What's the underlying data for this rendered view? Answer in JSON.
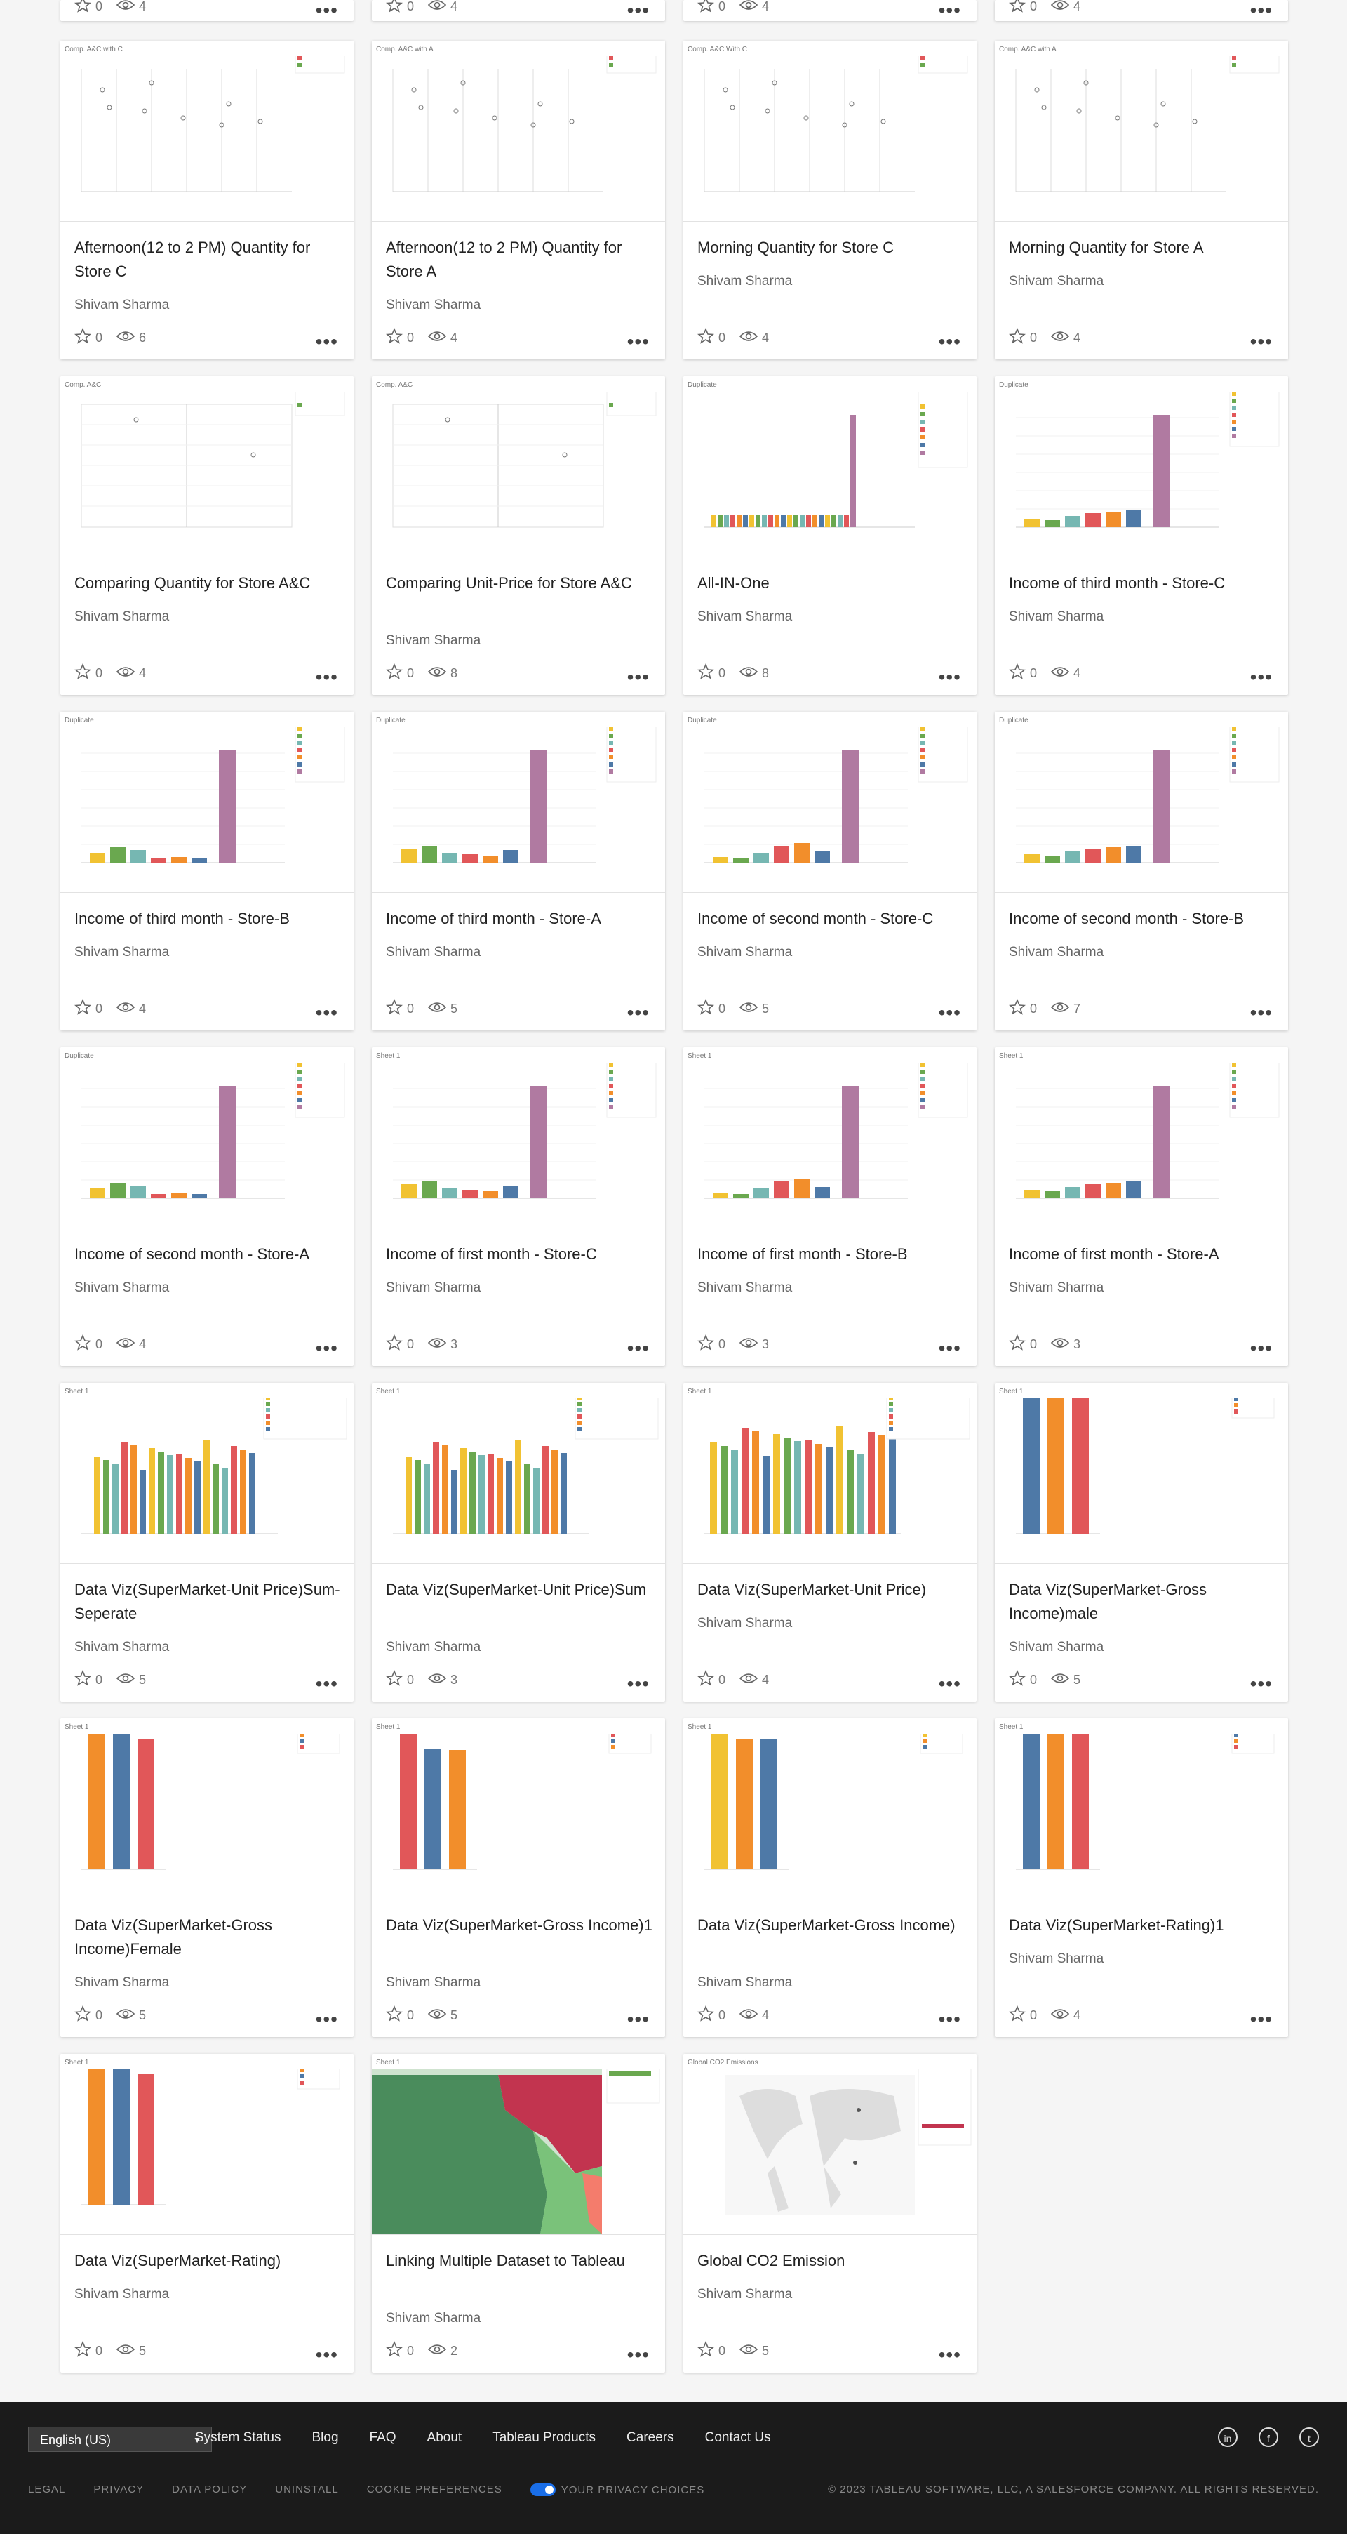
{
  "colors": {
    "accent": "#1a6ee8",
    "footer": "#1b1b1b",
    "card": "#ffffff",
    "bg": "#f5f5f5"
  },
  "top_partial": [
    {
      "favorites": "0",
      "views": "4"
    },
    {
      "favorites": "0",
      "views": "4"
    },
    {
      "favorites": "0",
      "views": "4"
    },
    {
      "favorites": "0",
      "views": "4"
    }
  ],
  "cards": [
    {
      "title": "Afternoon(12 to 2 PM) Quantity for Store C",
      "author": "Shivam Sharma",
      "favorites": "0",
      "views": "6",
      "thumb": "Comp. A&C with C",
      "kind": "scatter"
    },
    {
      "title": "Afternoon(12 to 2 PM) Quantity for Store A",
      "author": "Shivam Sharma",
      "favorites": "0",
      "views": "4",
      "thumb": "Comp. A&C with A",
      "kind": "scatter"
    },
    {
      "title": "Morning Quantity for Store C",
      "author": "Shivam Sharma",
      "favorites": "0",
      "views": "4",
      "thumb": "Comp. A&C With C",
      "kind": "scatter"
    },
    {
      "title": "Morning Quantity for Store A",
      "author": "Shivam Sharma",
      "favorites": "0",
      "views": "4",
      "thumb": "Comp. A&C with A",
      "kind": "scatter"
    },
    {
      "title": "Comparing Quantity for Store A&C",
      "author": "Shivam Sharma",
      "favorites": "0",
      "views": "4",
      "thumb": "Comp. A&C",
      "kind": "scatter2"
    },
    {
      "title": "Comparing Unit-Price for Store A&C",
      "author": "Shivam Sharma",
      "favorites": "0",
      "views": "8",
      "thumb": "Comp. A&C",
      "kind": "scatter2"
    },
    {
      "title": "All-IN-One",
      "author": "Shivam Sharma",
      "favorites": "0",
      "views": "8",
      "thumb": "Duplicate",
      "kind": "allin"
    },
    {
      "title": "Income of third month - Store-C",
      "author": "Shivam Sharma",
      "favorites": "0",
      "views": "4",
      "thumb": "Duplicate",
      "kind": "income"
    },
    {
      "title": "Income of third month - Store-B",
      "author": "Shivam Sharma",
      "favorites": "0",
      "views": "4",
      "thumb": "Duplicate",
      "kind": "income"
    },
    {
      "title": "Income of third month - Store-A",
      "author": "Shivam Sharma",
      "favorites": "0",
      "views": "5",
      "thumb": "Duplicate",
      "kind": "income"
    },
    {
      "title": "Income of second month - Store-C",
      "author": "Shivam Sharma",
      "favorites": "0",
      "views": "5",
      "thumb": "Duplicate",
      "kind": "income"
    },
    {
      "title": "Income of second month - Store-B",
      "author": "Shivam Sharma",
      "favorites": "0",
      "views": "7",
      "thumb": "Duplicate",
      "kind": "income"
    },
    {
      "title": "Income of second month - Store-A",
      "author": "Shivam Sharma",
      "favorites": "0",
      "views": "4",
      "thumb": "Duplicate",
      "kind": "income"
    },
    {
      "title": "Income of first month - Store-C",
      "author": "Shivam Sharma",
      "favorites": "0",
      "views": "3",
      "thumb": "Sheet 1",
      "kind": "income"
    },
    {
      "title": "Income of first month - Store-B",
      "author": "Shivam Sharma",
      "favorites": "0",
      "views": "3",
      "thumb": "Sheet 1",
      "kind": "income"
    },
    {
      "title": "Income of first month - Store-A",
      "author": "Shivam Sharma",
      "favorites": "0",
      "views": "3",
      "thumb": "Sheet 1",
      "kind": "income"
    },
    {
      "title": "Data Viz(SuperMarket-Unit Price)Sum-Seperate",
      "author": "Shivam Sharma",
      "favorites": "0",
      "views": "5",
      "thumb": "Sheet 1",
      "kind": "multibar"
    },
    {
      "title": "Data Viz(SuperMarket-Unit Price)Sum",
      "author": "Shivam Sharma",
      "favorites": "0",
      "views": "3",
      "thumb": "Sheet 1",
      "kind": "multibar"
    },
    {
      "title": "Data Viz(SuperMarket-Unit Price)",
      "author": "Shivam Sharma",
      "favorites": "0",
      "views": "4",
      "thumb": "Sheet 1",
      "kind": "multibar2"
    },
    {
      "title": "Data Viz(SuperMarket-Gross Income)male",
      "author": "Shivam Sharma",
      "favorites": "0",
      "views": "5",
      "thumb": "Sheet 1",
      "kind": "three"
    },
    {
      "title": "Data Viz(SuperMarket-Gross Income)Female",
      "author": "Shivam Sharma",
      "favorites": "0",
      "views": "5",
      "thumb": "Sheet 1",
      "kind": "three"
    },
    {
      "title": "Data Viz(SuperMarket-Gross Income)1",
      "author": "Shivam Sharma",
      "favorites": "0",
      "views": "5",
      "thumb": "Sheet 1",
      "kind": "three"
    },
    {
      "title": "Data Viz(SuperMarket-Gross Income)",
      "author": "Shivam Sharma",
      "favorites": "0",
      "views": "4",
      "thumb": "Sheet 1",
      "kind": "three"
    },
    {
      "title": "Data Viz(SuperMarket-Rating)1",
      "author": "Shivam Sharma",
      "favorites": "0",
      "views": "4",
      "thumb": "Sheet 1",
      "kind": "three"
    },
    {
      "title": "Data Viz(SuperMarket-Rating)",
      "author": "Shivam Sharma",
      "favorites": "0",
      "views": "5",
      "thumb": "Sheet 1",
      "kind": "three"
    },
    {
      "title": "Linking Multiple Dataset to Tableau",
      "author": "Shivam Sharma",
      "favorites": "0",
      "views": "2",
      "thumb": "Sheet 1",
      "kind": "map"
    },
    {
      "title": "Global CO2 Emission",
      "author": "Shivam Sharma",
      "favorites": "0",
      "views": "5",
      "thumb": "Global CO2 Emissions",
      "kind": "world"
    }
  ],
  "footer": {
    "language": "English (US)",
    "links": [
      "System Status",
      "Blog",
      "FAQ",
      "About",
      "Tableau Products",
      "Careers",
      "Contact Us"
    ],
    "legal": [
      "LEGAL",
      "PRIVACY",
      "DATA POLICY",
      "UNINSTALL",
      "COOKIE PREFERENCES"
    ],
    "privacy_choices": "YOUR PRIVACY CHOICES",
    "copyright": "© 2023 TABLEAU SOFTWARE, LLC, A SALESFORCE COMPANY. ALL RIGHTS RESERVED."
  }
}
